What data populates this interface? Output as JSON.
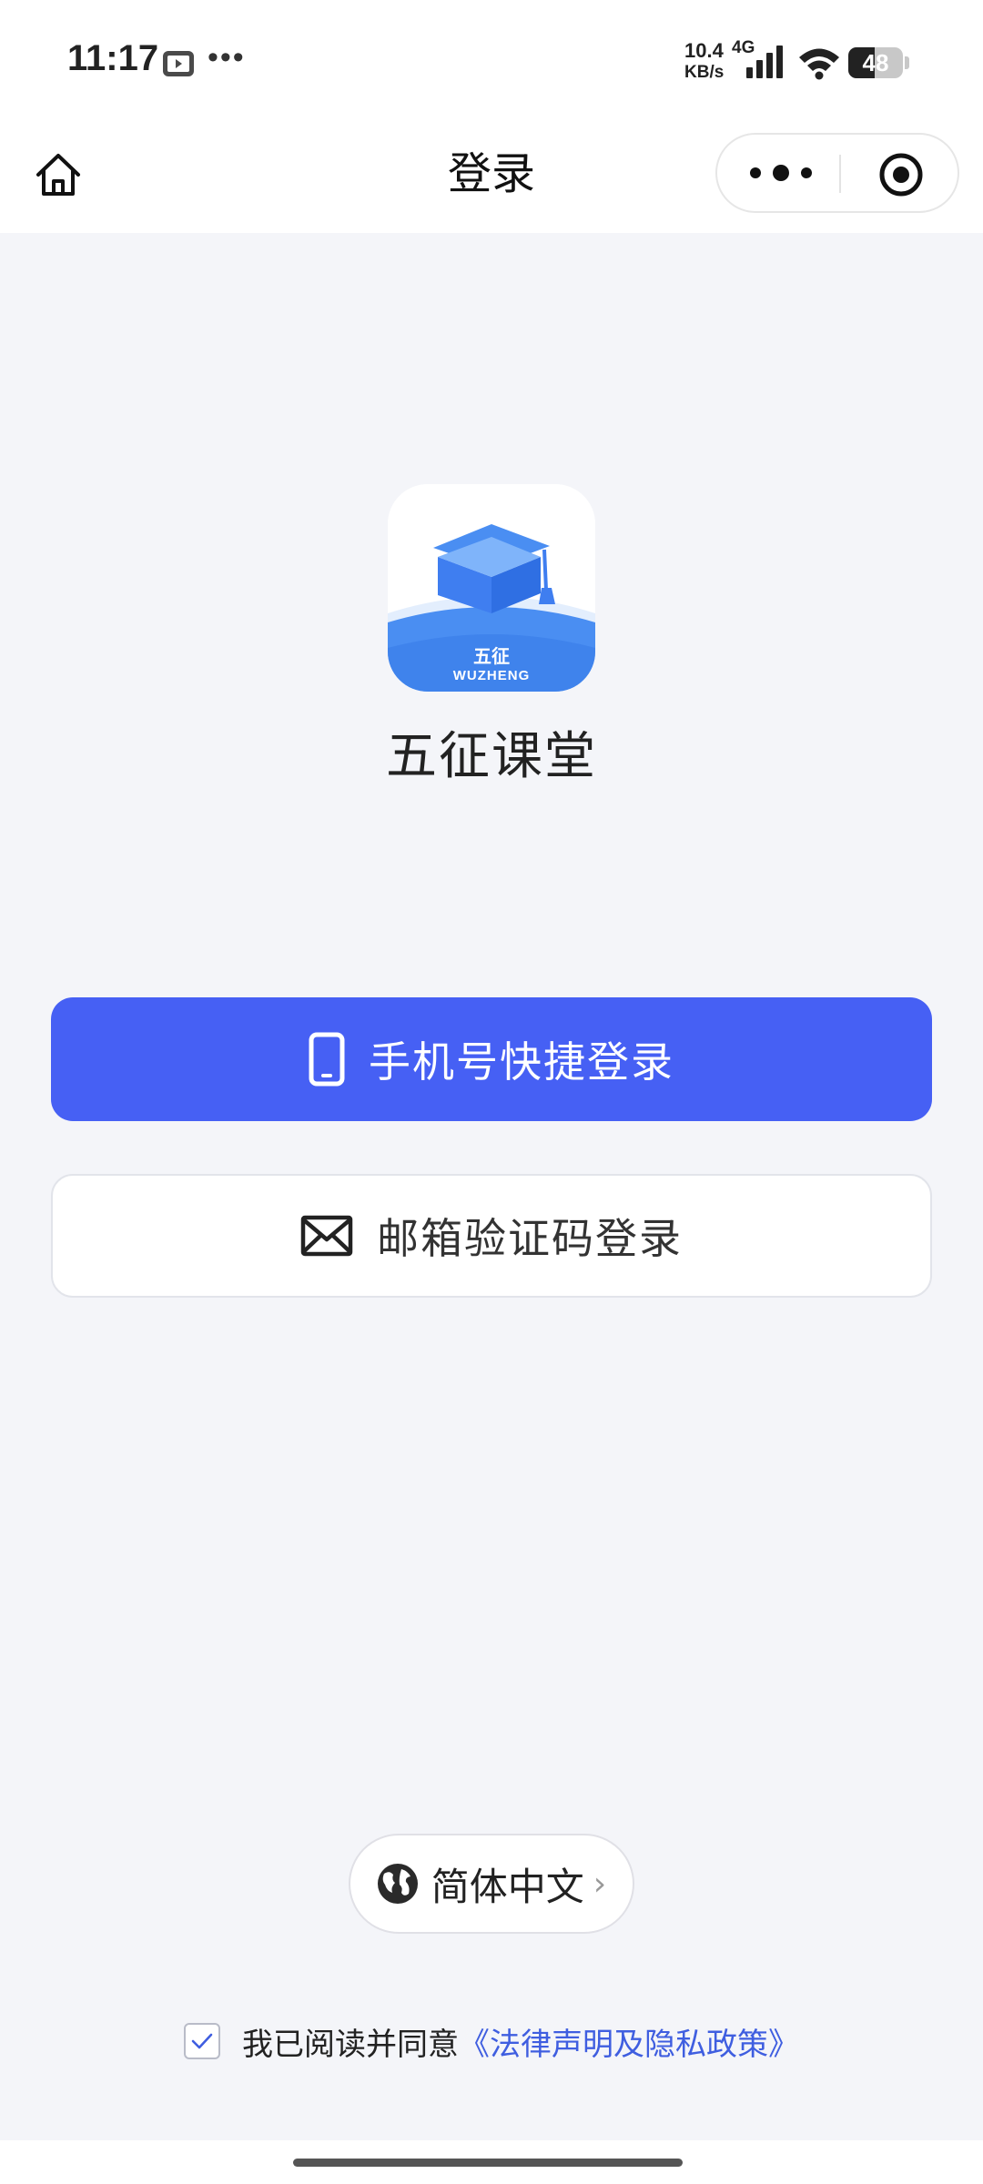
{
  "status_bar": {
    "time": "11:17",
    "net_speed_value": "10.4",
    "net_speed_unit": "KB/s",
    "network_type": "4G",
    "battery_level": "48",
    "battery_fraction": 0.48
  },
  "nav": {
    "title": "登录",
    "icons": {
      "home": "home-icon",
      "more": "more-dots-icon",
      "close": "close-mini-program-icon"
    }
  },
  "app": {
    "name": "五征课堂",
    "logo_text_cn": "五征",
    "logo_text_en": "WUZHENG"
  },
  "login_buttons": {
    "phone_label": "手机号快捷登录",
    "email_label": "邮箱验证码登录"
  },
  "language": {
    "label": "简体中文",
    "chevron": "›"
  },
  "agreement": {
    "text": "我已阅读并同意",
    "link": "《法律声明及隐私政策》",
    "checked": true
  },
  "colors": {
    "primary": "#4660f4",
    "link": "#3f5ee0",
    "background": "#f4f5f9"
  }
}
